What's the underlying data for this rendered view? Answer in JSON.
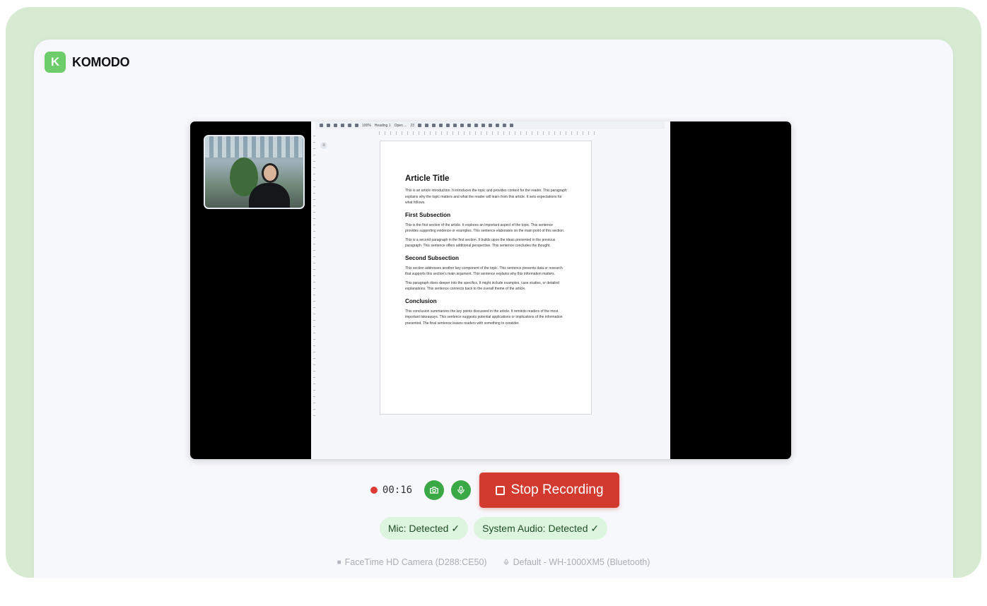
{
  "brand": {
    "logo_letter": "K",
    "name": "KOMODO"
  },
  "document_toolbar": {
    "zoom": "100%",
    "style": "Heading 1",
    "font": "Open ...",
    "font_size": "23"
  },
  "document": {
    "title": "Article Title",
    "intro": "This is an article introduction. It introduces the topic and provides context for the reader. This paragraph explains why the topic matters and what the reader will learn from this article. It sets expectations for what follows.",
    "sections": [
      {
        "heading": "First Subsection",
        "paragraphs": [
          "This is the first section of the article. It explores an important aspect of the topic. This sentence provides supporting evidence or examples. This sentence elaborates on the main point of this section.",
          "This is a second paragraph in the first section. It builds upon the ideas presented in the previous paragraph. This sentence offers additional perspective. This sentence concludes the thought."
        ]
      },
      {
        "heading": "Second Subsection",
        "paragraphs": [
          "This section addresses another key component of the topic. This sentence presents data or research that supports this section's main argument. This sentence explains why this information matters.",
          "This paragraph dives deeper into the specifics. It might include examples, case studies, or detailed explanations. This sentence connects back to the overall theme of the article."
        ]
      },
      {
        "heading": "Conclusion",
        "paragraphs": [
          "This conclusion summarizes the key points discussed in the article. It reminds readers of the most important takeaways. This sentence suggests potential applications or implications of the information presented. The final sentence leaves readers with something to consider."
        ]
      }
    ]
  },
  "recording": {
    "timer": "00:16",
    "stop_label": "Stop Recording",
    "camera_icon": "camera-icon",
    "mic_icon": "mic-icon"
  },
  "status": {
    "mic": "Mic: Detected ✓",
    "system_audio": "System Audio: Detected ✓"
  },
  "devices": {
    "camera": "FaceTime HD Camera (D288:CE50)",
    "microphone": "Default - WH-1000XM5 (Bluetooth)"
  },
  "colors": {
    "accent_green": "#3aa845",
    "stop_red": "#d33a2f",
    "badge_bg": "#ddf5df",
    "frame_green": "#d6ebd2"
  }
}
